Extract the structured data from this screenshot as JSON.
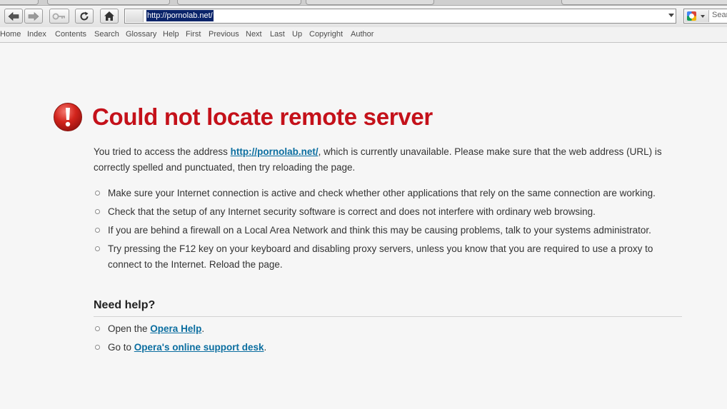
{
  "toolbar": {
    "back_icon": "arrow-left-icon",
    "forward_icon": "arrow-right-icon",
    "wand_icon": "key-icon",
    "reload_icon": "reload-icon",
    "home_icon": "home-icon",
    "address": "http://pornolab.net/",
    "search_placeholder": "Sear"
  },
  "navbar": {
    "items": [
      "Home",
      "Index",
      "Contents",
      "Search",
      "Glossary",
      "Help",
      "First",
      "Previous",
      "Next",
      "Last",
      "Up",
      "Copyright",
      "Author"
    ]
  },
  "error": {
    "icon": "exclamation-icon",
    "title": "Could not locate remote server",
    "intro_before": "You tried to access the address ",
    "intro_link": "http://pornolab.net/",
    "intro_after": ", which is currently unavailable. Please make sure that the web address (URL) is correctly spelled and punctuated, then try reloading the page.",
    "tips": [
      "Make sure your Internet connection is active and check whether other applications that rely on the same connection are working.",
      "Check that the setup of any Internet security software is correct and does not interfere with ordinary web browsing.",
      "If you are behind a firewall on a Local Area Network and think this may be causing problems, talk to your systems administrator.",
      "Try pressing the F12 key on your keyboard and disabling proxy servers, unless you know that you are required to use a proxy to connect to the Internet. Reload the page."
    ]
  },
  "help": {
    "heading": "Need help?",
    "item1_before": "Open the ",
    "item1_link": "Opera Help",
    "item1_after": ".",
    "item2_before": "Go to ",
    "item2_link": "Opera's online support desk",
    "item2_after": "."
  },
  "colors": {
    "title": "#c4111a",
    "link": "#0b6ea0",
    "background": "#f6f6f6"
  }
}
